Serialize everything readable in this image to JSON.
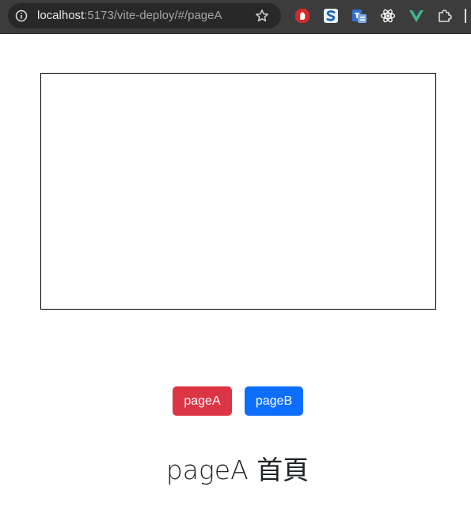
{
  "browser": {
    "url_host": "localhost",
    "url_rest": ":5173/vite-deploy/#/pageA",
    "icons": [
      "info-icon",
      "bookmark-star-icon",
      "adblock-icon",
      "s-extension-icon",
      "translate-extension-icon",
      "react-devtools-icon",
      "vue-devtools-icon",
      "extensions-puzzle-icon"
    ]
  },
  "nav": {
    "page_a_label": "pageA",
    "page_b_label": "pageB"
  },
  "main": {
    "title": "pageA 首頁"
  },
  "colors": {
    "danger": "#dc3545",
    "primary": "#0d6efd",
    "toolbar": "#3c3c3c"
  }
}
